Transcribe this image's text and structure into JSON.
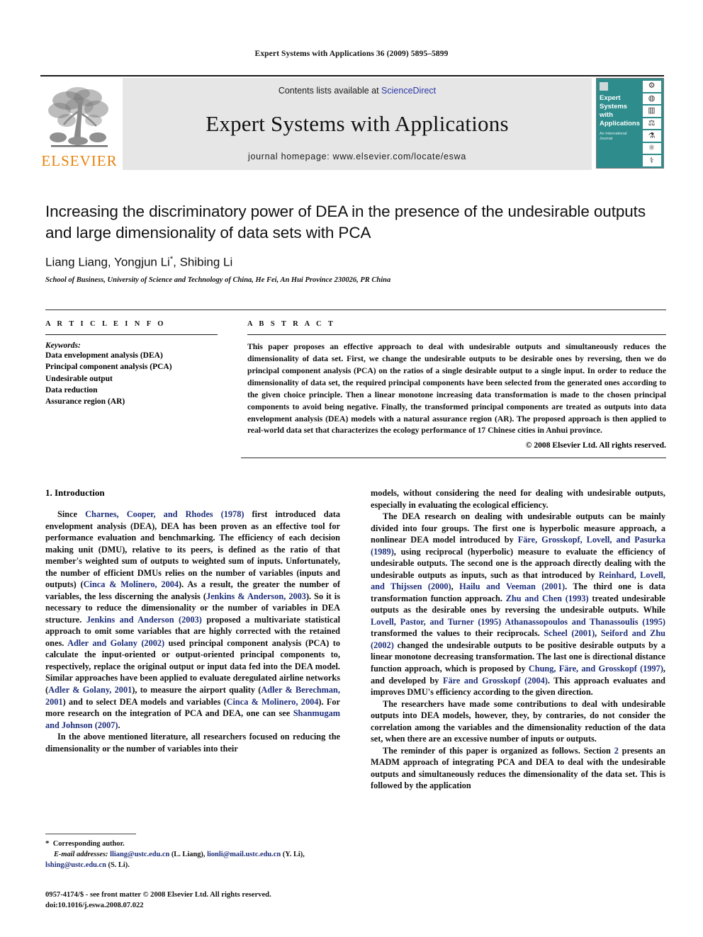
{
  "running_head": "Expert Systems with Applications 36 (2009) 5895–5899",
  "masthead": {
    "publisher_wordmark": "ELSEVIER",
    "contents_prefix": "Contents lists available at ",
    "contents_link": "ScienceDirect",
    "journal_name": "Expert Systems with Applications",
    "homepage": "journal homepage: www.elsevier.com/locate/eswa",
    "cover": {
      "title_lines": [
        "Expert",
        "Systems",
        "with",
        "Applications"
      ],
      "subtitle": "An International Journal",
      "background_color": "#2e8c8c"
    },
    "accent_color": "#E8820C",
    "link_color": "#2b37a8"
  },
  "article": {
    "title": "Increasing the discriminatory power of DEA in the presence of the undesirable outputs and large dimensionality of data sets with PCA",
    "authors": "Liang Liang, Yongjun Li",
    "authors_tail": ", Shibing Li",
    "corresponding_marker": "*",
    "affiliation": "School of Business, University of Science and Technology of China, He Fei, An Hui Province 230026, PR China"
  },
  "article_info": {
    "heading": "A R T I C L E   I N F O",
    "keywords_label": "Keywords:",
    "keywords": [
      "Data envelopment analysis (DEA)",
      "Principal component analysis (PCA)",
      "Undesirable output",
      "Data reduction",
      "Assurance region (AR)"
    ]
  },
  "abstract": {
    "heading": "A B S T R A C T",
    "text": "This paper proposes an effective approach to deal with undesirable outputs and simultaneously reduces the dimensionality of data set. First, we change the undesirable outputs to be desirable ones by reversing, then we do principal component analysis (PCA) on the ratios of a single desirable output to a single input. In order to reduce the dimensionality of data set, the required principal components have been selected from the generated ones according to the given choice principle. Then a linear monotone increasing data transformation is made to the chosen principal components to avoid being negative. Finally, the transformed principal components are treated as outputs into data envelopment analysis (DEA) models with a natural assurance region (AR). The proposed approach is then applied to real-world data set that characterizes the ecology performance of 17 Chinese cities in Anhui province.",
    "copyright": "© 2008 Elsevier Ltd. All rights reserved."
  },
  "sections": {
    "intro_heading": "1. Introduction"
  },
  "body": {
    "left": [
      {
        "runs": [
          {
            "t": "Since ",
            "r": false
          },
          {
            "t": "Charnes, Cooper, and Rhodes (1978)",
            "r": true
          },
          {
            "t": " first introduced data envelopment analysis (DEA), DEA has been proven as an effective tool for performance evaluation and benchmarking. The efficiency of each decision making unit (DMU), relative to its peers, is defined as the ratio of that member's weighted sum of outputs to weighted sum of inputs. Unfortunately, the number of efficient DMUs relies on the number of variables (inputs and outputs) (",
            "r": false
          },
          {
            "t": "Cinca & Molinero, 2004",
            "r": true
          },
          {
            "t": "). As a result, the greater the number of variables, the less discerning the analysis (",
            "r": false
          },
          {
            "t": "Jenkins & Anderson, 2003",
            "r": true
          },
          {
            "t": "). So it is necessary to reduce the dimensionality or the number of variables in DEA structure. ",
            "r": false
          },
          {
            "t": "Jenkins and Anderson (2003)",
            "r": true
          },
          {
            "t": " proposed a multivariate statistical approach to omit some variables that are highly corrected with the retained ones. ",
            "r": false
          },
          {
            "t": "Adler and Golany (2002)",
            "r": true
          },
          {
            "t": " used principal component analysis (PCA) to calculate the input-oriented or output-oriented principal components to, respectively, replace the original output or input data fed into the DEA model. Similar approaches have been applied to evaluate deregulated airline networks (",
            "r": false
          },
          {
            "t": "Adler & Golany, 2001",
            "r": true
          },
          {
            "t": "), to measure the airport quality (",
            "r": false
          },
          {
            "t": "Adler & Berechman, 2001",
            "r": true
          },
          {
            "t": ") and to select DEA models and variables (",
            "r": false
          },
          {
            "t": "Cinca & Molinero, 2004",
            "r": true
          },
          {
            "t": "). For more research on the integration of PCA and DEA, one can see ",
            "r": false
          },
          {
            "t": "Shanmugam and Johnson (2007)",
            "r": true
          },
          {
            "t": ".",
            "r": false
          }
        ]
      },
      {
        "runs": [
          {
            "t": "In the above mentioned literature, all researchers focused on reducing the dimensionality or the number of variables into their",
            "r": false
          }
        ]
      }
    ],
    "right": [
      {
        "runs": [
          {
            "t": "models, without considering the need for dealing with undesirable outputs, especially in evaluating the ecological efficiency.",
            "r": false
          }
        ],
        "noindent": true
      },
      {
        "runs": [
          {
            "t": "The DEA research on dealing with undesirable outputs can be mainly divided into four groups. The first one is hyperbolic measure approach, a nonlinear DEA model introduced by ",
            "r": false
          },
          {
            "t": "Färe, Grosskopf, Lovell, and Pasurka (1989)",
            "r": true
          },
          {
            "t": ", using reciprocal (hyperbolic) measure to evaluate the efficiency of undesirable outputs. The second one is the approach directly dealing with the undesirable outputs as inputs, such as that introduced by ",
            "r": false
          },
          {
            "t": "Reinhard, Lovell, and Thijssen (2000)",
            "r": true
          },
          {
            "t": ", ",
            "r": false
          },
          {
            "t": "Hailu and Veeman (2001)",
            "r": true
          },
          {
            "t": ". The third one is data transformation function approach. ",
            "r": false
          },
          {
            "t": "Zhu and Chen (1993)",
            "r": true
          },
          {
            "t": " treated undesirable outputs as the desirable ones by reversing the undesirable outputs. While ",
            "r": false
          },
          {
            "t": "Lovell, Pastor, and Turner (1995)",
            "r": true
          },
          {
            "t": " ",
            "r": false
          },
          {
            "t": "Athanassopoulos and Thanassoulis (1995)",
            "r": true
          },
          {
            "t": " transformed the values to their reciprocals. ",
            "r": false
          },
          {
            "t": "Scheel (2001)",
            "r": true
          },
          {
            "t": ", ",
            "r": false
          },
          {
            "t": "Seiford and Zhu (2002)",
            "r": true
          },
          {
            "t": " changed the undesirable outputs to be positive desirable outputs by a linear monotone decreasing transformation. The last one is directional distance function approach, which is proposed by ",
            "r": false
          },
          {
            "t": "Chung, Färe, and Grosskopf (1997)",
            "r": true
          },
          {
            "t": ", and developed by ",
            "r": false
          },
          {
            "t": "Färe and Grosskopf (2004)",
            "r": true
          },
          {
            "t": ". This approach evaluates and improves DMU's efficiency according to the given direction.",
            "r": false
          }
        ]
      },
      {
        "runs": [
          {
            "t": "The researchers have made some contributions to deal with undesirable outputs into DEA models, however, they, by contraries, do not consider the correlation among the variables and the dimensionality reduction of the data set, when there are an excessive number of inputs or outputs.",
            "r": false
          }
        ]
      },
      {
        "runs": [
          {
            "t": "The reminder of this paper is organized as follows. Section ",
            "r": false
          },
          {
            "t": "2",
            "r": true
          },
          {
            "t": " presents an MADM approach of integrating PCA and DEA to deal with the undesirable outputs and simultaneously reduces the dimensionality of the data set. This is followed by the application",
            "r": false
          }
        ]
      }
    ]
  },
  "footnotes": {
    "corresponding": "Corresponding author.",
    "email_label": "E-mail addresses:",
    "emails": [
      {
        "addr": "lliang@ustc.edu.cn",
        "who": " (L. Liang), "
      },
      {
        "addr": "lionli@mail.ustc.edu.cn",
        "who": " (Y. Li), "
      },
      {
        "addr": "lshing@ustc.edu.cn",
        "who": " (S. Li)."
      }
    ]
  },
  "imprint": {
    "line1": "0957-4174/$ - see front matter © 2008 Elsevier Ltd. All rights reserved.",
    "line2": "doi:10.1016/j.eswa.2008.07.022"
  }
}
